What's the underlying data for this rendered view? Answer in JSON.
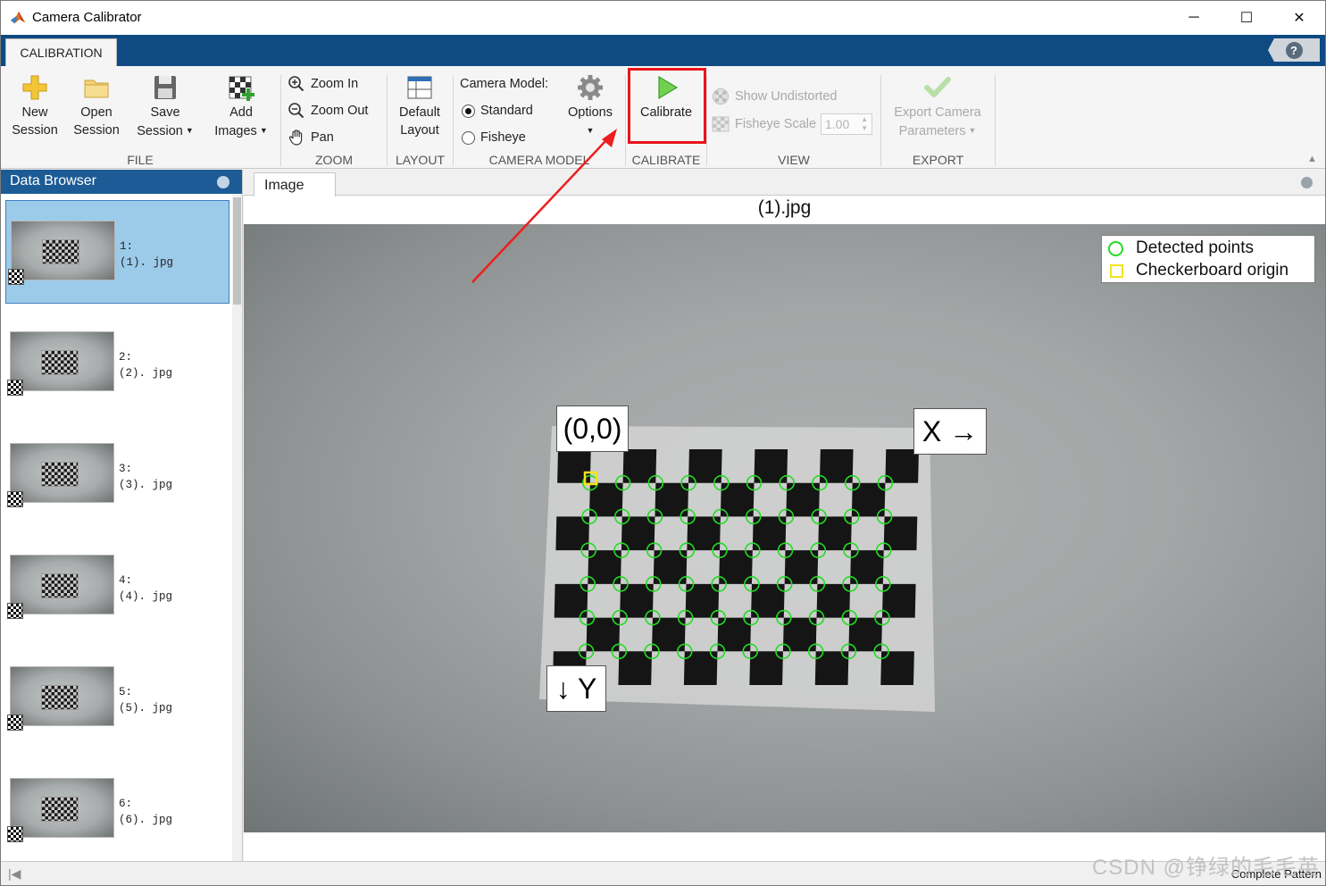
{
  "window": {
    "title": "Camera Calibrator",
    "minimize": "─",
    "maximize": "☐",
    "close": "✕"
  },
  "tabs": {
    "active": "CALIBRATION",
    "help": "?"
  },
  "ribbon": {
    "file": {
      "label": "FILE",
      "new_line1": "New",
      "new_line2": "Session",
      "open_line1": "Open",
      "open_line2": "Session",
      "save_line1": "Save",
      "save_line2": "Session",
      "add_line1": "Add",
      "add_line2": "Images"
    },
    "zoom": {
      "label": "ZOOM",
      "zoom_in": "Zoom In",
      "zoom_out": "Zoom Out",
      "pan": "Pan"
    },
    "layout": {
      "label": "LAYOUT",
      "default_line1": "Default",
      "default_line2": "Layout"
    },
    "camera_model": {
      "label": "CAMERA MODEL",
      "heading": "Camera Model:",
      "standard": "Standard",
      "fisheye": "Fisheye",
      "options": "Options",
      "selected": "Standard"
    },
    "calibrate": {
      "label": "CALIBRATE",
      "button": "Calibrate"
    },
    "view": {
      "label": "VIEW",
      "show_undistorted": "Show Undistorted",
      "fisheye_scale": "Fisheye Scale",
      "fisheye_scale_value": "1.00"
    },
    "export": {
      "label": "EXPORT",
      "line1": "Export Camera",
      "line2": "Parameters"
    }
  },
  "data_browser": {
    "title": "Data Browser",
    "items": [
      {
        "index": "1:",
        "file": "(1). jpg",
        "selected": true
      },
      {
        "index": "2:",
        "file": "(2). jpg",
        "selected": false
      },
      {
        "index": "3:",
        "file": "(3). jpg",
        "selected": false
      },
      {
        "index": "4:",
        "file": "(4). jpg",
        "selected": false
      },
      {
        "index": "5:",
        "file": "(5). jpg",
        "selected": false
      },
      {
        "index": "6:",
        "file": "(6). jpg",
        "selected": false
      }
    ]
  },
  "image_panel": {
    "tab": "Image",
    "title": "(1).jpg",
    "legend": {
      "detected": "Detected points",
      "origin": "Checkerboard origin"
    },
    "origin_label": "(0,0)",
    "x_label": "X →",
    "y_label": "↓ Y"
  },
  "colors": {
    "ribbon_tab_blue": "#0f4a82",
    "browser_header": "#1d5b96",
    "selected_item": "#9ccbea",
    "detected_point": "#22dd22",
    "origin_marker": "#f2e41c",
    "highlight_red": "#e8141c"
  },
  "status": {
    "left_icon": "|◀",
    "right": "Complete Pattern"
  },
  "watermark": "CSDN @铮绿的毛毛英"
}
